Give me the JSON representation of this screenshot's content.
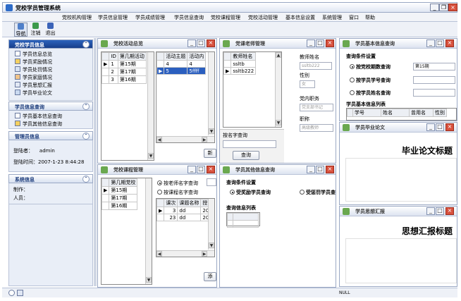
{
  "app": {
    "title": "党校学员管理系统"
  },
  "menu": [
    "党校机构管理",
    "学员信息管理",
    "学员成绩管理",
    "学员信息查询",
    "党校课程管理",
    "党校活动管理",
    "基本信息设置",
    "系统管理",
    "窗口",
    "帮助"
  ],
  "toolbar": {
    "nav": "导航",
    "logout": "注销",
    "exit": "退出"
  },
  "left": {
    "section1": {
      "title": "党校学员信息",
      "items": [
        "学员信息总览",
        "学员奖励情况",
        "学员处罚情况",
        "学员家庭情况",
        "学员思想汇报",
        "学员毕业论文"
      ]
    },
    "section2": {
      "title": "学员信息查询",
      "items": [
        "学员基本信息查询",
        "学员其他信息查询"
      ]
    },
    "section3": {
      "title": "管理员信息",
      "user_label": "登陆者：",
      "user": "admin",
      "time_label": "登陆时间：",
      "time": "2007-1-23 8:44:28"
    },
    "section4": {
      "title": "系统信息",
      "maker": "制作：",
      "staff": "人员："
    }
  },
  "win_activity": {
    "title": "党校活动总览",
    "left_grid": {
      "headers": [
        "ID",
        "第几期活动"
      ],
      "rows": [
        [
          "1",
          "第15期"
        ],
        [
          "2",
          "第17期"
        ],
        [
          "3",
          "第16期"
        ]
      ]
    },
    "right_grid": {
      "headers": [
        "活动主题",
        "活动内"
      ],
      "rows": [
        [
          "4",
          "4"
        ],
        [
          "5",
          "5ffff"
        ]
      ]
    },
    "button": "新"
  },
  "win_teacher": {
    "title": "党课老师管理",
    "grid": {
      "headers": [
        "教师姓名"
      ],
      "rows": [
        "ssltb",
        "ssltb222"
      ]
    },
    "name_label": "教师姓名",
    "name_value": "ssltb222",
    "sex_label": "性别",
    "sex_value": "女",
    "role_label": "党内职务",
    "role_value": "党支部书记",
    "title_label": "职称",
    "title_value": "高级教师",
    "search_label": "按名字查询",
    "search_button": "查询"
  },
  "win_basic": {
    "title": "学员基本信息查询",
    "cond_label": "查询条件设置",
    "opt1": "按党校期数查询",
    "opt1_value": "第15期",
    "opt2": "按学员学号查询",
    "opt3": "按学员姓名查询",
    "list_label": "学员基本信息列表",
    "headers": [
      "学号",
      "姓名",
      "曾用名",
      "性别"
    ]
  },
  "win_paper": {
    "title": "学员毕业论文",
    "heading": "毕业论文标题"
  },
  "win_report": {
    "title": "学员思想汇报",
    "heading": "思想汇报标题"
  },
  "win_course": {
    "title": "党校课程管理",
    "grid": {
      "headers": [
        "第几期党校"
      ],
      "rows": [
        "第15期",
        "第17期",
        "第16期"
      ]
    },
    "opt1": "按老师名字查询",
    "opt2": "按课程名字查询",
    "grid2": {
      "headers": [
        "课次",
        "课题名称",
        "授"
      ],
      "rows": [
        [
          "3",
          "dd",
          "20"
        ],
        [
          "23",
          "dd",
          "20"
        ]
      ]
    },
    "button": "添"
  },
  "win_other": {
    "title": "学员其他信息查询",
    "cond_label": "查询条件设置",
    "opt1": "受奖励学员查询",
    "opt2": "受惩罚学员查",
    "list_label": "查询信息列表"
  },
  "status": {
    "text": "NULL"
  }
}
